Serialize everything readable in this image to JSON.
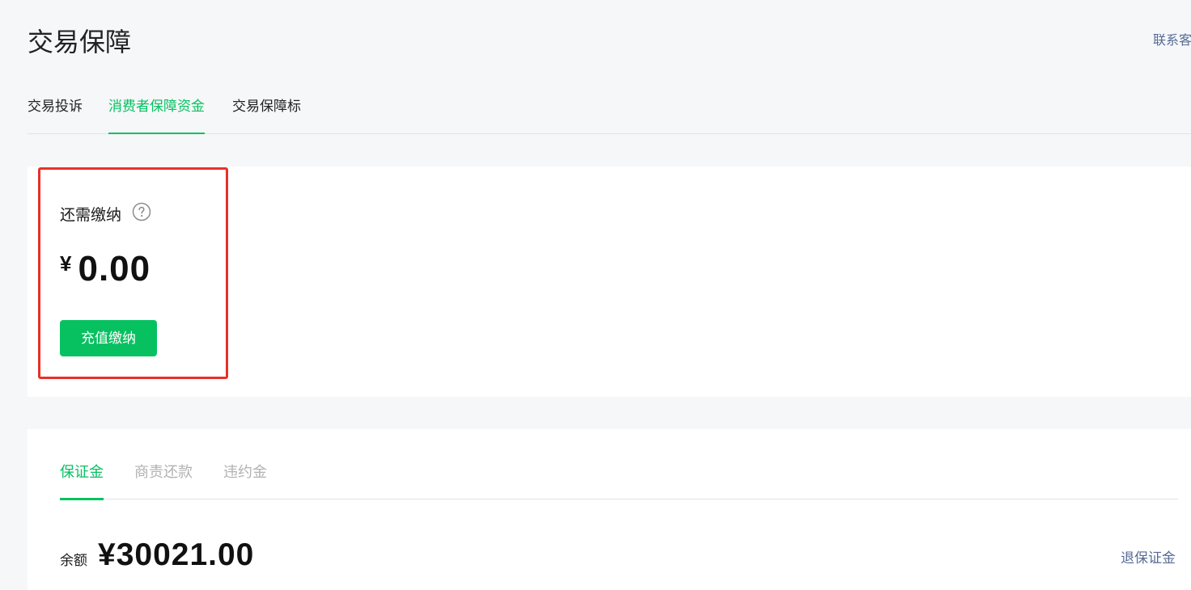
{
  "header": {
    "title": "交易保障",
    "contact_link": "联系客"
  },
  "top_tabs": [
    {
      "label": "交易投诉",
      "active": false
    },
    {
      "label": "消费者保障资金",
      "active": true
    },
    {
      "label": "交易保障标",
      "active": false
    }
  ],
  "due": {
    "label": "还需缴纳",
    "currency": "¥",
    "amount": "0.00",
    "help_icon": "question-circle-icon",
    "button_label": "充值缴纳"
  },
  "sub_tabs": [
    {
      "label": "保证金",
      "active": true
    },
    {
      "label": "商责还款",
      "active": false
    },
    {
      "label": "违约金",
      "active": false
    }
  ],
  "balance": {
    "label": "余额",
    "amount": "¥30021.00",
    "refund_link": "退保证金"
  },
  "colors": {
    "accent": "#07c160",
    "link": "#576b95",
    "highlight_border": "#e8302a",
    "page_bg": "#f6f7f9",
    "inactive_tab": "#b2b2b2"
  }
}
